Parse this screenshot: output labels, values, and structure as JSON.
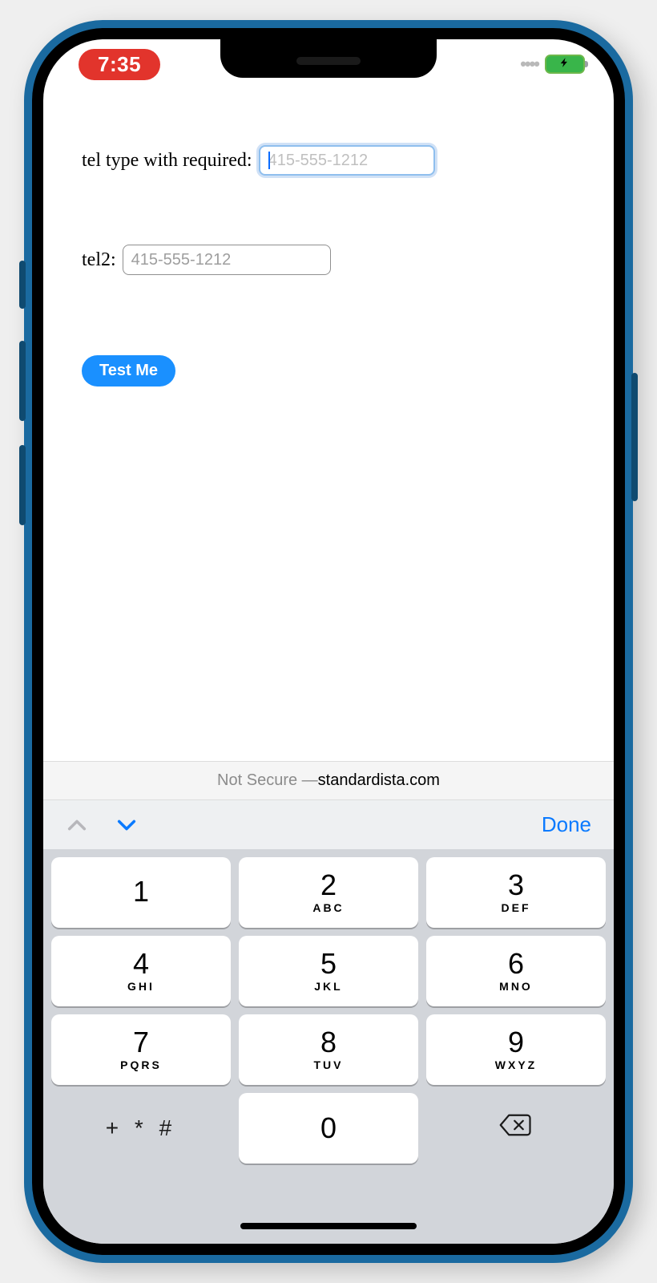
{
  "status": {
    "time": "7:35"
  },
  "form": {
    "tel1_label": "tel type with required: ",
    "tel1_placeholder": "415-555-1212",
    "tel2_label": "tel2: ",
    "tel2_placeholder": "415-555-1212",
    "button_label": "Test Me"
  },
  "urlbar": {
    "prefix": "Not Secure — ",
    "domain": "standardista.com"
  },
  "accessory": {
    "done": "Done"
  },
  "keypad": {
    "keys": [
      {
        "num": "1",
        "sub": ""
      },
      {
        "num": "2",
        "sub": "ABC"
      },
      {
        "num": "3",
        "sub": "DEF"
      },
      {
        "num": "4",
        "sub": "GHI"
      },
      {
        "num": "5",
        "sub": "JKL"
      },
      {
        "num": "6",
        "sub": "MNO"
      },
      {
        "num": "7",
        "sub": "PQRS"
      },
      {
        "num": "8",
        "sub": "TUV"
      },
      {
        "num": "9",
        "sub": "WXYZ"
      }
    ],
    "symbols": "+ * #",
    "zero": "0"
  }
}
